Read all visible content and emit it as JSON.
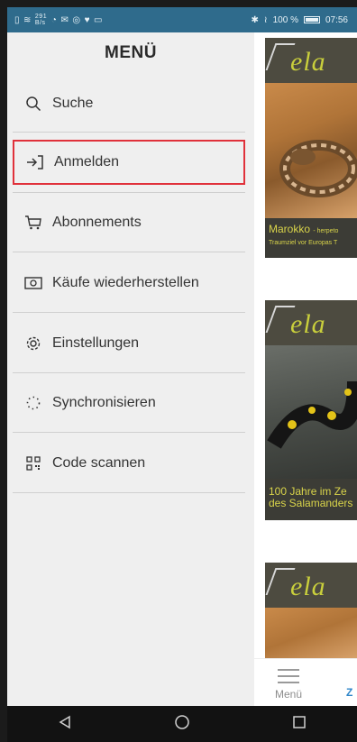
{
  "status_bar": {
    "left_icons": [
      "sim-icon",
      "wifi-icon",
      "data-icon",
      "messenger-icon",
      "mail-icon",
      "whatsapp-icon",
      "twitter-icon",
      "gallery-icon"
    ],
    "speed_text": "291 B/s",
    "right_text": "100 %",
    "time": "07:56"
  },
  "drawer": {
    "title": "MENÜ",
    "items": [
      {
        "label": "Suche",
        "icon": "search-icon"
      },
      {
        "label": "Anmelden",
        "icon": "login-icon"
      },
      {
        "label": "Abonnements",
        "icon": "cart-icon"
      },
      {
        "label": "Käufe wiederherstellen",
        "icon": "restore-purchases-icon"
      },
      {
        "label": "Einstellungen",
        "icon": "gear-icon"
      },
      {
        "label": "Synchronisieren",
        "icon": "sync-icon"
      },
      {
        "label": "Code scannen",
        "icon": "qr-code-icon"
      }
    ]
  },
  "content": {
    "covers": [
      {
        "logo": "ela",
        "caption": "Marokko",
        "caption_suffix": "- herpeto",
        "subcaption": "Traumziel vor Europas T"
      },
      {
        "logo": "ela",
        "caption": "100 Jahre im Ze des Salamanders",
        "subcaption": ""
      },
      {
        "logo": "ela",
        "caption": "",
        "subcaption": ""
      }
    ]
  },
  "tabbar": {
    "menu_label": "Menü",
    "partial_label": "Z"
  },
  "colors": {
    "status_bar": "#2f6b8c",
    "drawer_bg": "#efefef",
    "highlight_border": "#e0313b",
    "accent": "#2f86c9"
  }
}
